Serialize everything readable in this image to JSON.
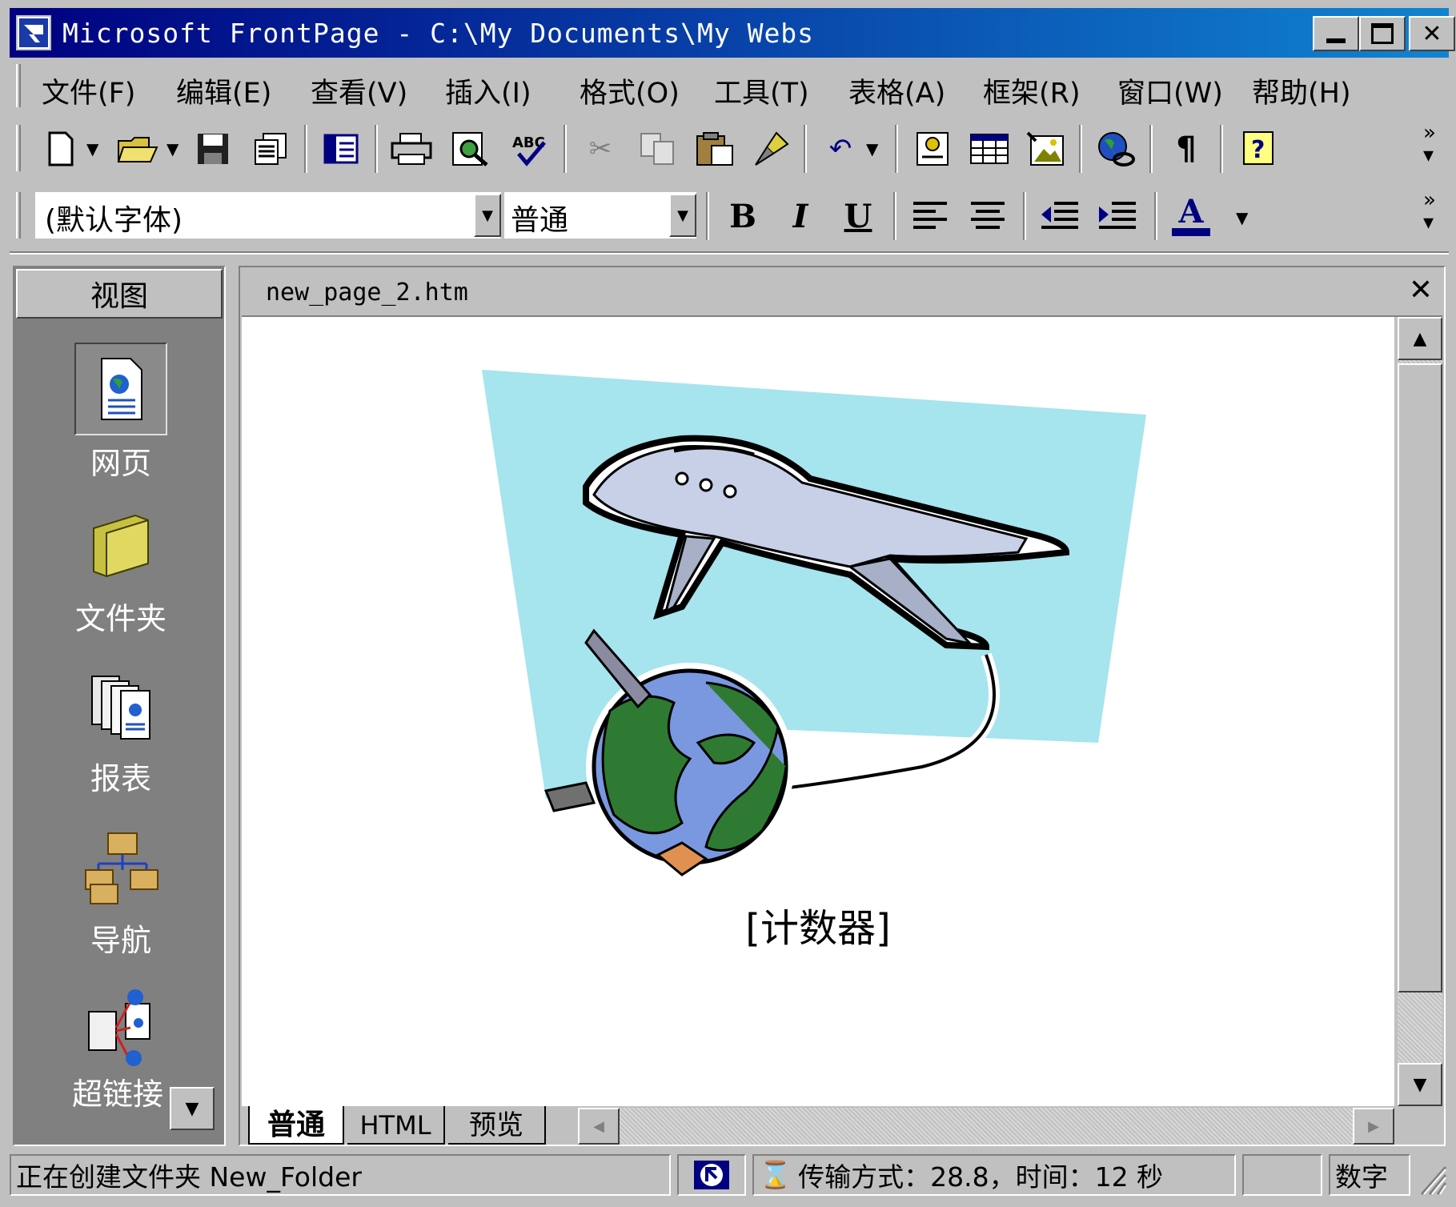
{
  "window": {
    "title": "Microsoft FrontPage - C:\\My Documents\\My Webs",
    "app_icon": "frontpage-icon",
    "controls": [
      "minimize-icon",
      "maximize-icon",
      "close-icon"
    ]
  },
  "menu": [
    "文件(F)",
    "编辑(E)",
    "查看(V)",
    "插入(I)",
    "格式(O)",
    "工具(T)",
    "表格(A)",
    "框架(R)",
    "窗口(W)",
    "帮助(H)"
  ],
  "standard_toolbar": {
    "buttons": [
      "new-page",
      "open",
      "save",
      "publish",
      "folder-list",
      "print",
      "preview-in-browser",
      "spelling",
      "cut",
      "copy",
      "paste",
      "format-painter",
      "undo",
      "insert-component",
      "insert-table",
      "insert-picture",
      "hyperlink",
      "show-all",
      "help"
    ]
  },
  "format_toolbar": {
    "font_value": "(默认字体)",
    "style_value": "普通",
    "bold_label": "B",
    "italic_label": "I",
    "underline_label": "U",
    "font_color_label": "A"
  },
  "views_panel": {
    "header": "视图",
    "items": [
      {
        "label": "网页",
        "icon": "page-icon"
      },
      {
        "label": "文件夹",
        "icon": "folder-icon"
      },
      {
        "label": "报表",
        "icon": "reports-icon"
      },
      {
        "label": "导航",
        "icon": "navigation-icon"
      },
      {
        "label": "超链接",
        "icon": "hyperlinks-icon"
      }
    ]
  },
  "document": {
    "tab_name": "new_page_2.htm",
    "counter_text": "[计数器]",
    "view_tabs": [
      "普通",
      "HTML",
      "预览"
    ]
  },
  "status": {
    "message": "正在创建文件夹 New_Folder",
    "transfer": "传输方式：28.8，时间：12 秒",
    "numlock": "数字"
  },
  "colors": {
    "title_start": "#000080",
    "title_end": "#1084d0",
    "face": "#c0c0c0",
    "views_bg": "#808080",
    "sky": "#a6e4ee"
  }
}
